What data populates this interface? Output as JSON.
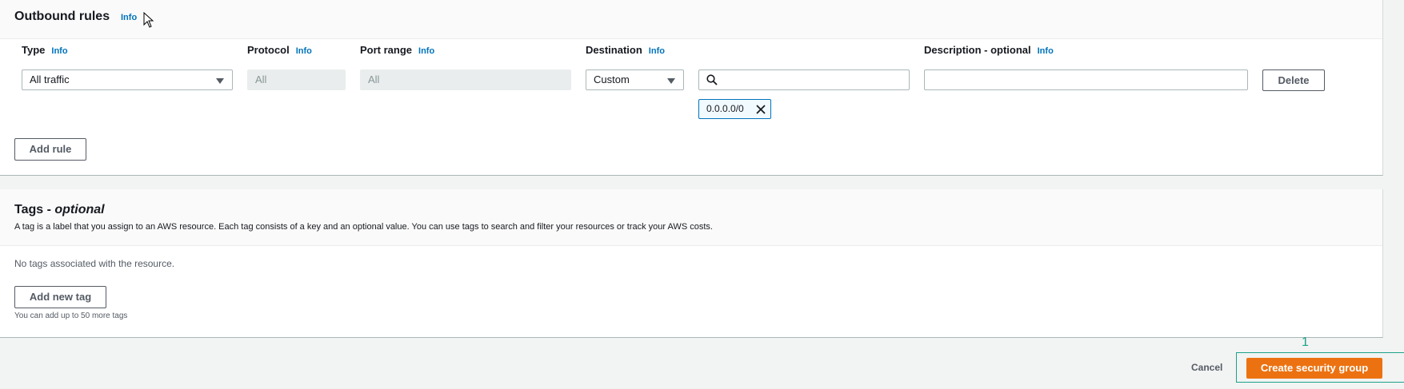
{
  "outbound": {
    "title": "Outbound rules",
    "title_info": "Info",
    "columns": {
      "type": {
        "label": "Type",
        "info": "Info"
      },
      "protocol": {
        "label": "Protocol",
        "info": "Info"
      },
      "port_range": {
        "label": "Port range",
        "info": "Info"
      },
      "destination": {
        "label": "Destination",
        "info": "Info"
      },
      "description": {
        "label": "Description - optional",
        "info": "Info"
      }
    },
    "rule": {
      "type_value": "All traffic",
      "protocol_value": "All",
      "port_range_value": "All",
      "destination_value": "Custom",
      "search_value": "",
      "description_value": "",
      "token": "0.0.0.0/0",
      "delete_label": "Delete"
    },
    "add_rule_label": "Add rule"
  },
  "tags": {
    "title_prefix": "Tags - ",
    "title_italic": "optional",
    "description": "A tag is a label that you assign to an AWS resource. Each tag consists of a key and an optional value. You can use tags to search and filter your resources or track your AWS costs.",
    "empty_text": "No tags associated with the resource.",
    "add_tag_label": "Add new tag",
    "hint": "You can add up to 50 more tags"
  },
  "footer": {
    "cancel_label": "Cancel",
    "create_label": "Create security group",
    "annotation_number": "1"
  },
  "colors": {
    "primary": "#ec7211",
    "link": "#0073bb",
    "annotation": "#1aa38a"
  }
}
